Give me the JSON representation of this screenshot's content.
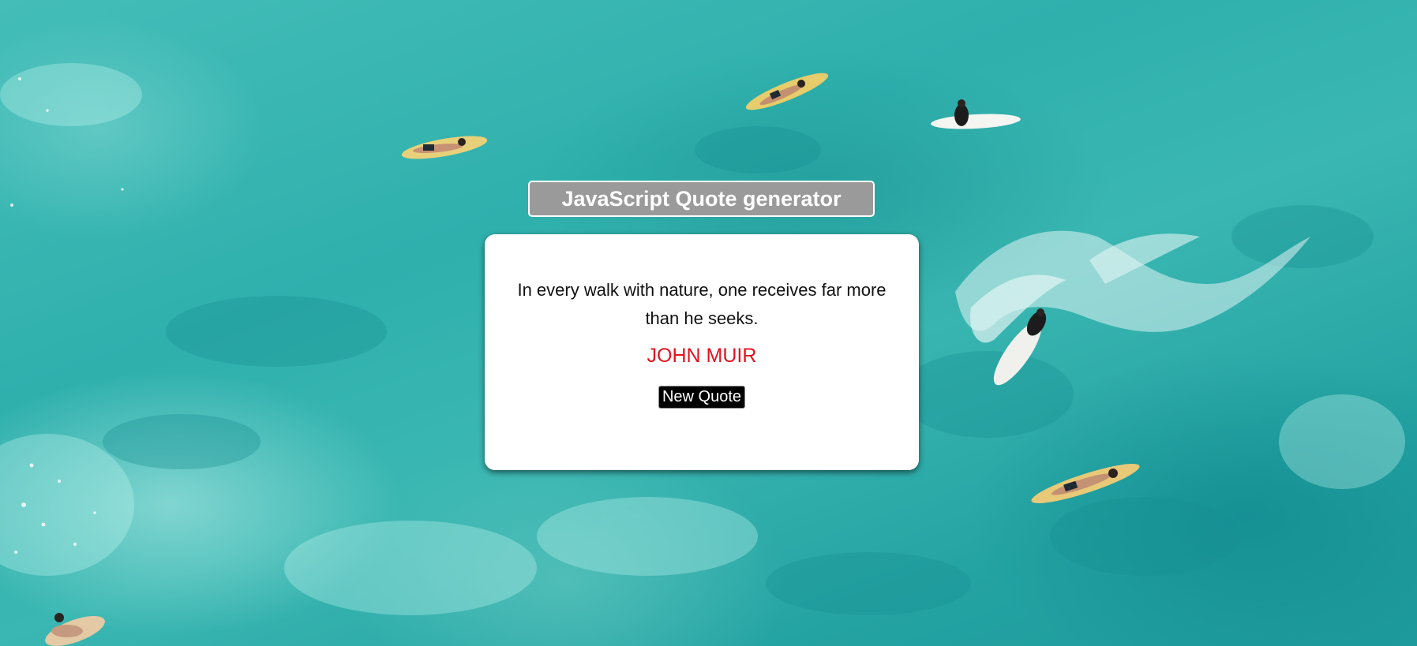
{
  "page": {
    "title": "JavaScript Quote generator",
    "background_image": "aerial-ocean-surfers-photo"
  },
  "quote": {
    "text": "In every walk with nature, one receives far more than he seeks.",
    "author": "JOHN MUIR"
  },
  "controls": {
    "new_quote_label": "New Quote"
  },
  "colors": {
    "title_badge_background": "#9a9a9a",
    "card_background": "#ffffff",
    "author_text": "#e2131c",
    "button_background": "#000000",
    "button_text": "#ffffff",
    "ocean": "#2fb0ad"
  }
}
